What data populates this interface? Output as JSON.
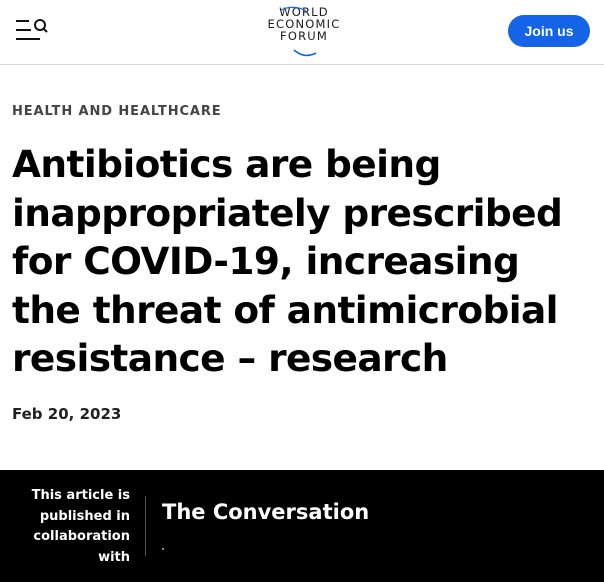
{
  "header": {
    "menu_icon": "menu-search-icon",
    "logo": {
      "lines": [
        "WORLD",
        "ECONOMIC",
        "FORUM"
      ],
      "accent_color": "#1564e8"
    },
    "join_label": "Join us",
    "join_color": "#1564e8"
  },
  "article": {
    "category": "HEALTH AND HEALTHCARE",
    "title": "Antibiotics are being inappropriately prescribed for COVID-19, increasing the threat of antimicrobial resistance – research",
    "date": "Feb 20, 2023"
  },
  "collaboration": {
    "label": "This article is published in collaboration with",
    "partner": "The Conversation"
  }
}
